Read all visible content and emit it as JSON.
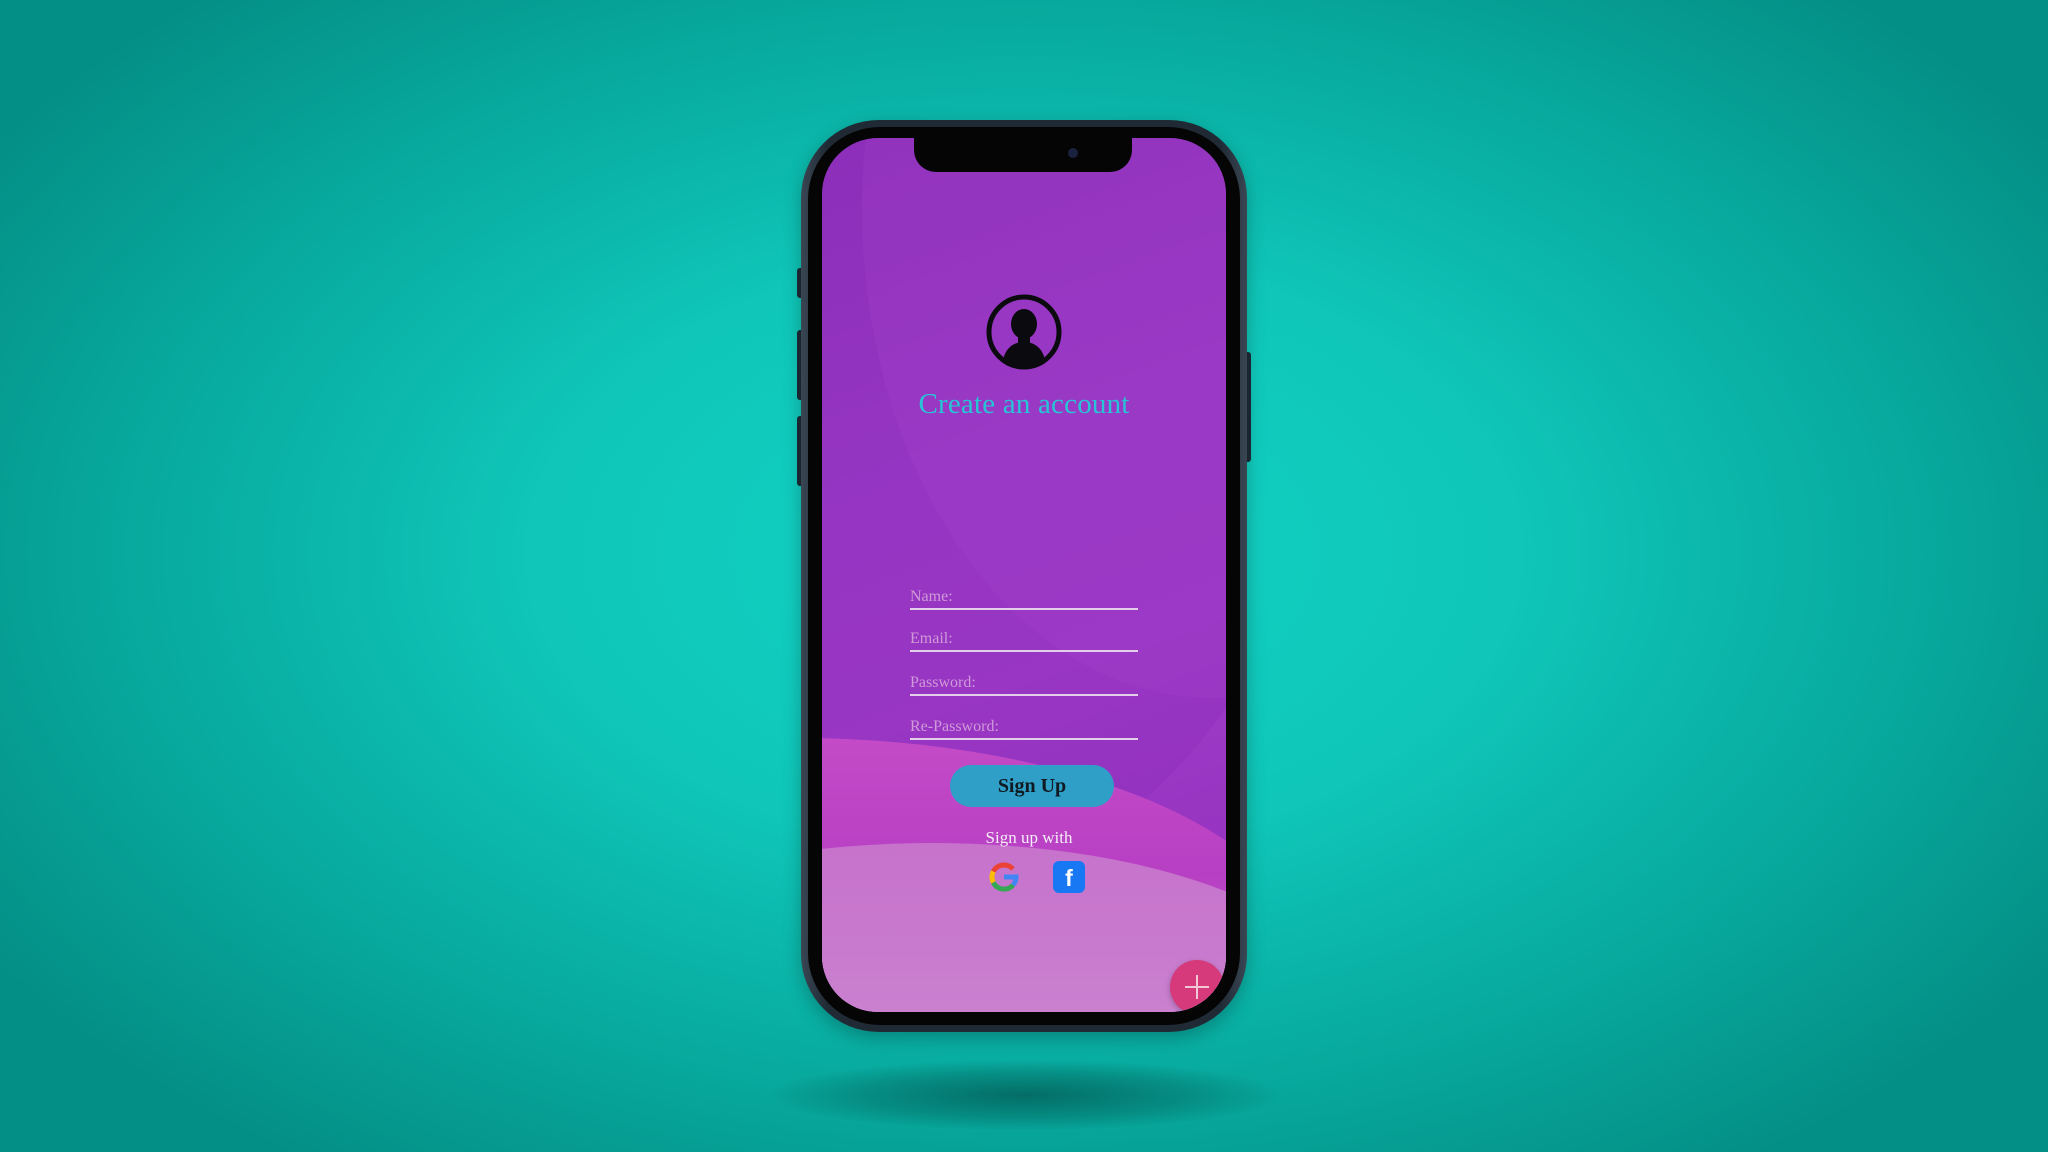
{
  "form": {
    "title": "Create an account",
    "name_placeholder": "Name:",
    "email_placeholder": "Email:",
    "password_placeholder": "Password:",
    "repassword_placeholder": "Re-Password:"
  },
  "buttons": {
    "signup_label": "Sign Up",
    "facebook_letter": "f"
  },
  "social": {
    "label": "Sign up with",
    "providers": [
      "google-icon",
      "facebook-icon"
    ]
  },
  "icons": {
    "avatar": "user-avatar-icon",
    "fab": "plus-icon"
  },
  "colors": {
    "background": "#0fc6b8",
    "screen": "#9a3ac6",
    "title": "#27c4d6",
    "signup_button": "#2f9fc7",
    "fab": "#d63a7a",
    "facebook": "#1877f2"
  }
}
